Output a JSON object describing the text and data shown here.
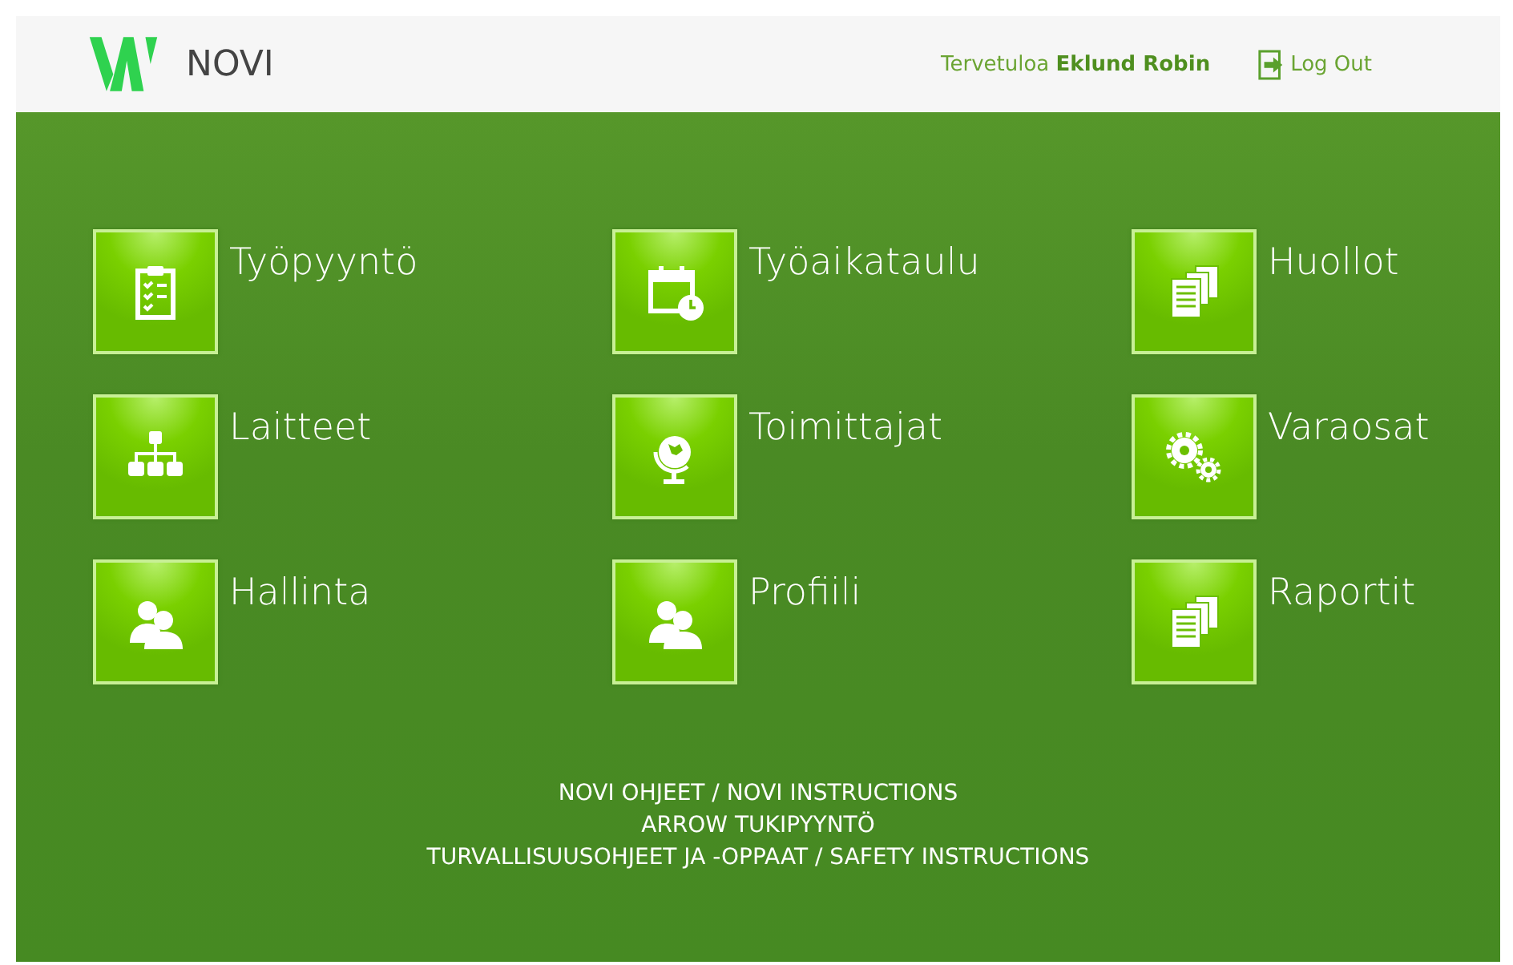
{
  "header": {
    "logo_text": "NOVI",
    "greeting": "Tervetuloa",
    "user_name": "Eklund Robin",
    "logout": "Log Out"
  },
  "tiles": [
    {
      "label": "Työpyyntö",
      "kind": "clipboard"
    },
    {
      "label": "Työaikataulu",
      "kind": "calendar"
    },
    {
      "label": "Huollot",
      "kind": "documents"
    },
    {
      "label": "Laitteet",
      "kind": "hierarchy"
    },
    {
      "label": "Toimittajat",
      "kind": "globe"
    },
    {
      "label": "Varaosat",
      "kind": "gears"
    },
    {
      "label": "Hallinta",
      "kind": "users"
    },
    {
      "label": "Profiili",
      "kind": "users"
    },
    {
      "label": "Raportit",
      "kind": "documents"
    }
  ],
  "footer_links": [
    "NOVI OHJEET / NOVI INSTRUCTIONS",
    "ARROW TUKIPYYNTÖ",
    "TURVALLISUUSOHJEET JA -OPPAAT / SAFETY INSTRUCTIONS"
  ]
}
